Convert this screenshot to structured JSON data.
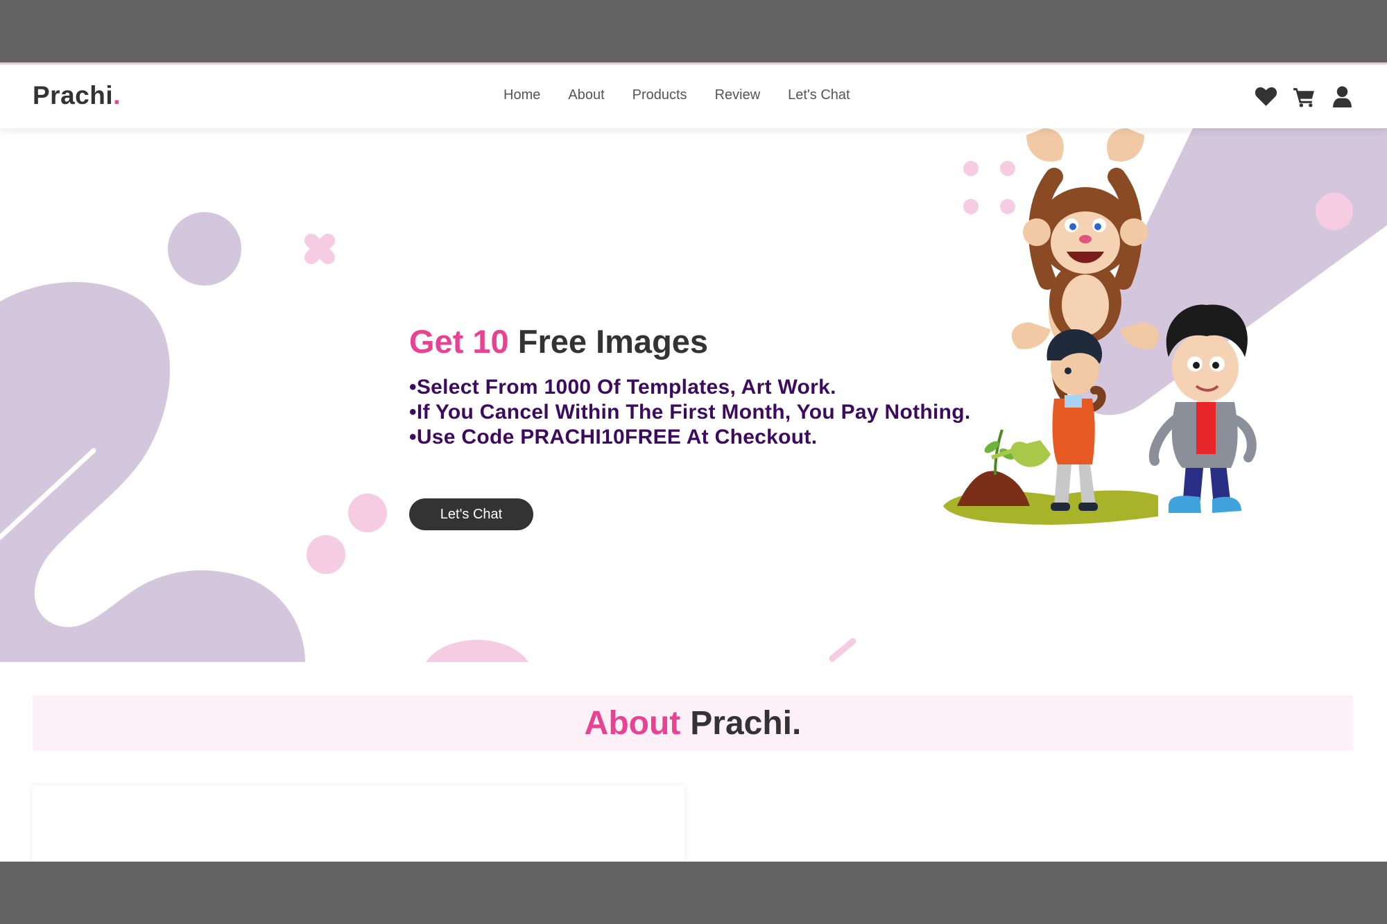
{
  "header": {
    "logo_text": "Prachi",
    "logo_dot": ".",
    "nav": [
      {
        "label": "Home"
      },
      {
        "label": "About"
      },
      {
        "label": "Products"
      },
      {
        "label": "Review"
      },
      {
        "label": "Let's Chat"
      }
    ],
    "icons": [
      "heart-icon",
      "cart-icon",
      "user-icon"
    ]
  },
  "hero": {
    "title_accent": "Get 10",
    "title_rest": "Free Images",
    "bullets": [
      "Select From 1000 Of Templates, Art Work.",
      "If You Cancel Within The First Month, You Pay Nothing.",
      "Use Code PRACHI10FREE At Checkout."
    ],
    "button_label": "Let's Chat"
  },
  "about": {
    "heading_accent": "About",
    "heading_rest": "Prachi."
  },
  "colors": {
    "accent": "#e84393",
    "dark": "#333333",
    "bullet_text": "#3c0a5e",
    "lavender": "#d3c6dd",
    "pink_light": "#f6cce2",
    "about_bg": "#fdf0f7",
    "frame": "#636363"
  }
}
